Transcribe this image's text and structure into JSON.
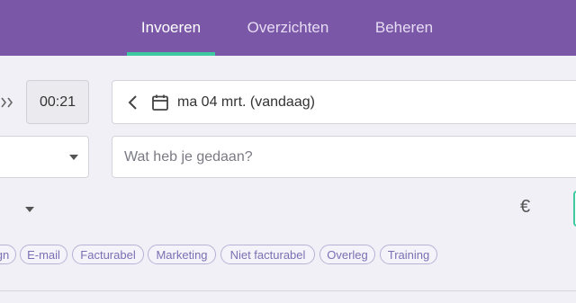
{
  "nav": {
    "tabs": [
      {
        "label": "Invoeren",
        "active": true
      },
      {
        "label": "Overzichten",
        "active": false
      },
      {
        "label": "Beheren",
        "active": false
      }
    ]
  },
  "entry": {
    "duration": "00:21",
    "date_label": "ma 04 mrt. (vandaag)",
    "description_placeholder": "Wat heb je gedaan?",
    "currency_symbol": "€"
  },
  "tags": [
    "gn",
    "E-mail",
    "Facturabel",
    "Marketing",
    "Niet facturabel",
    "Overleg",
    "Training"
  ],
  "colors": {
    "topbar": "#7b57a8",
    "accent": "#3ec9a0",
    "tag_text": "#7a70b3"
  },
  "icons": {
    "date_prev": "chevron-left-icon",
    "calendar": "calendar-icon",
    "select": "caret-down-icon"
  }
}
